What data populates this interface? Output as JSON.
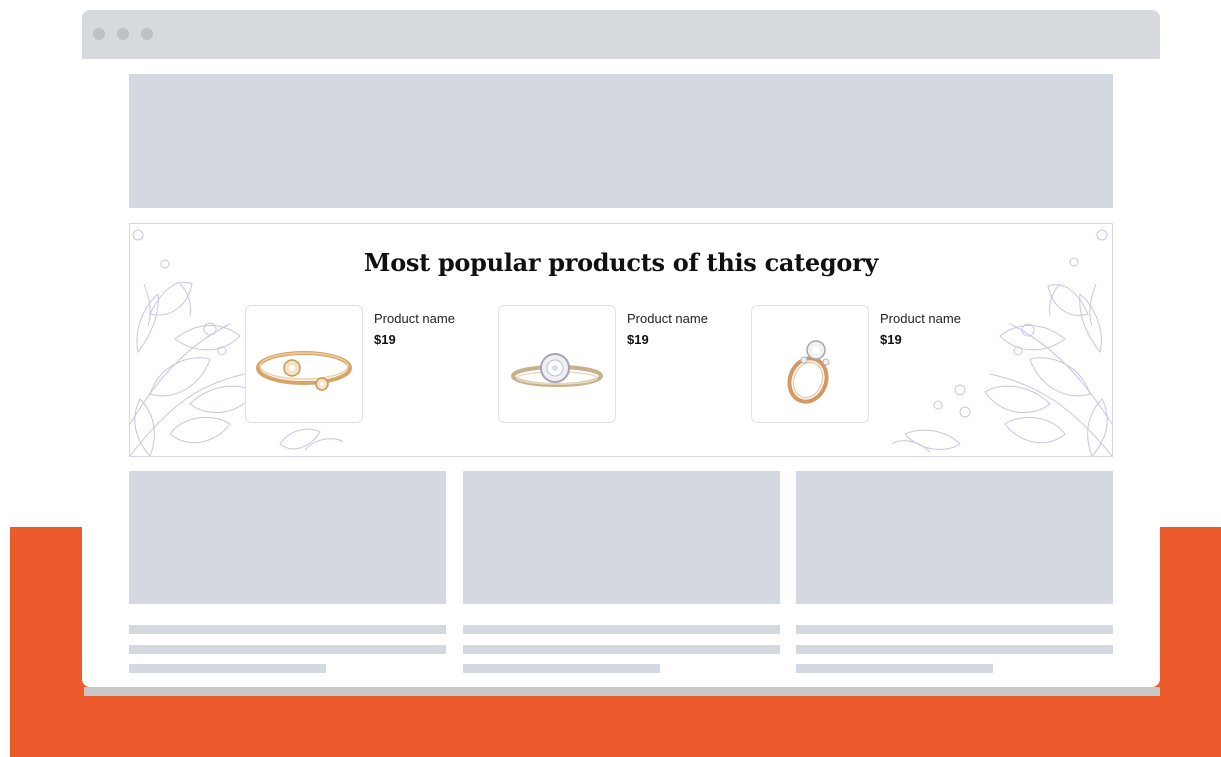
{
  "popular": {
    "title": "Most popular products of this category",
    "products": [
      {
        "name": "Product name",
        "price": "$19",
        "image": "twisted-gold-ring-icon"
      },
      {
        "name": "Product name",
        "price": "$19",
        "image": "halo-diamond-ring-icon"
      },
      {
        "name": "Product name",
        "price": "$19",
        "image": "solitaire-gold-ring-icon"
      }
    ]
  },
  "colors": {
    "accent_orange": "#EC5B2B",
    "placeholder_gray": "#D4D9E1",
    "titlebar_gray": "#D6D9DE",
    "leaf_outline": "#C9C3E6"
  }
}
